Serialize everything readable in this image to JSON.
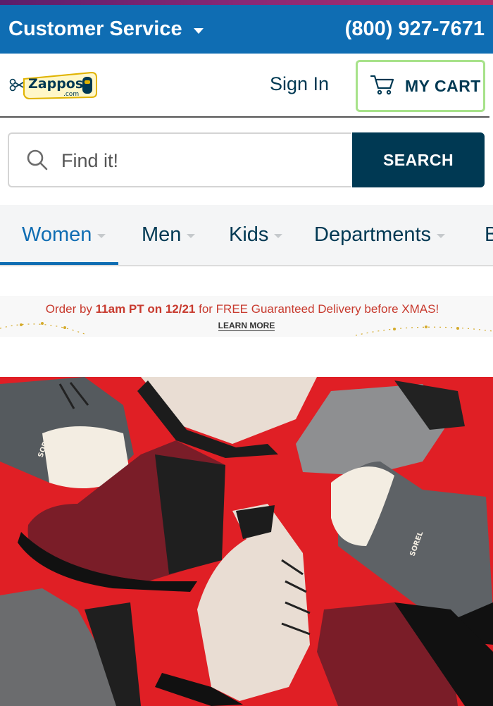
{
  "topbar": {
    "customer_service": "Customer Service",
    "phone": "(800) 927-7671"
  },
  "header": {
    "logo_alt": "Zappos.com",
    "logo_text": "Zappos",
    "logo_sub": ".com",
    "sign_in": "Sign In",
    "cart_label": "MY CART"
  },
  "search": {
    "placeholder": "Find it!",
    "button_label": "SEARCH"
  },
  "nav": {
    "items": [
      {
        "label": "Women",
        "active": true
      },
      {
        "label": "Men"
      },
      {
        "label": "Kids"
      },
      {
        "label": "Departments"
      },
      {
        "label": "Brands"
      }
    ]
  },
  "promo": {
    "text_prefix": "Order by ",
    "text_bold": "11am PT on 12/21",
    "text_suffix": " for FREE Guaranteed Delivery before XMAS!",
    "link": "LEARN MORE"
  },
  "hero": {
    "alt": "Sorel boots on red background",
    "brand_mark": "SOREL"
  },
  "colors": {
    "topbar_blue": "#0f6db3",
    "navy": "#003953",
    "cart_border": "#a7e28a",
    "promo_red": "#c83a2e",
    "hero_red": "#e01f25"
  }
}
